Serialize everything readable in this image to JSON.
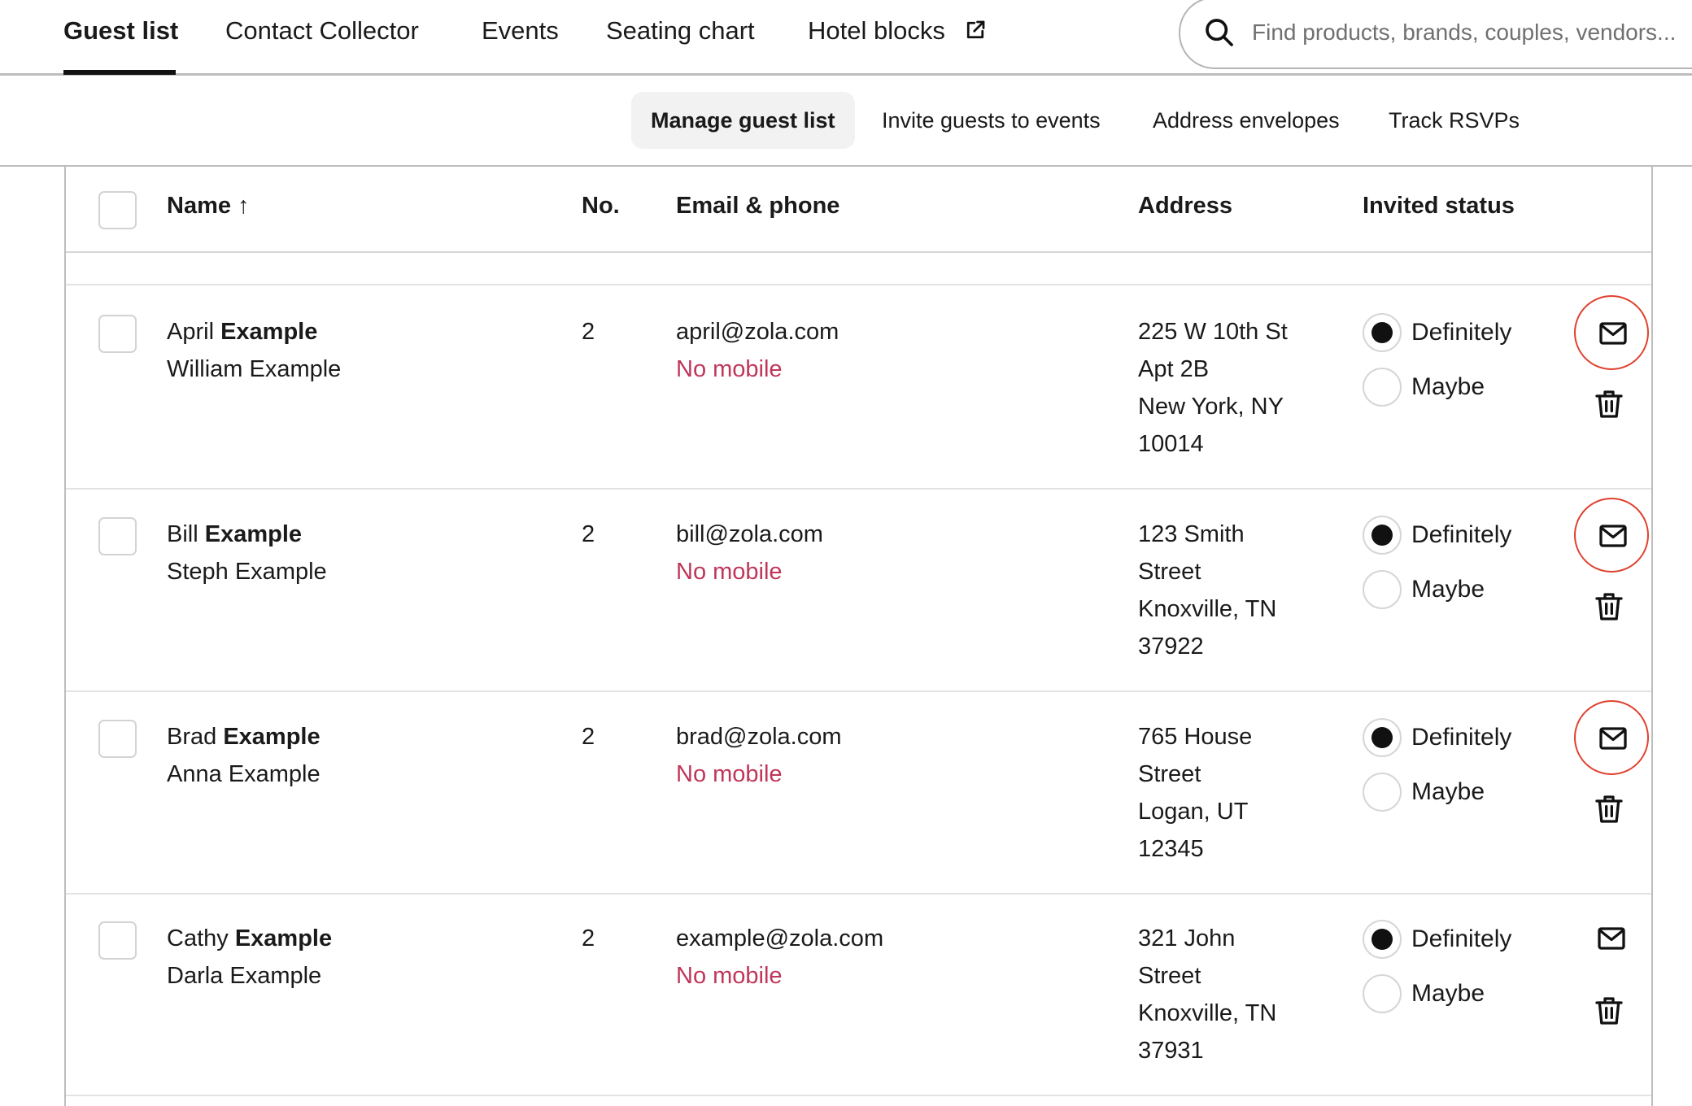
{
  "top_nav": {
    "tabs": [
      {
        "label": "Guest list",
        "active": true
      },
      {
        "label": "Contact Collector",
        "active": false
      },
      {
        "label": "Events",
        "active": false
      },
      {
        "label": "Seating chart",
        "active": false
      },
      {
        "label": "Hotel blocks",
        "active": false,
        "icon": "external-link-icon"
      }
    ],
    "search": {
      "placeholder": "Find products, brands, couples, vendors...",
      "value": "",
      "icon": "search-icon"
    }
  },
  "sub_nav": {
    "items": [
      {
        "label": "Manage guest list",
        "active": true
      },
      {
        "label": "Invite guests to events",
        "active": false
      },
      {
        "label": "Address envelopes",
        "active": false
      },
      {
        "label": "Track RSVPs",
        "active": false
      }
    ]
  },
  "table": {
    "columns": {
      "name": "Name",
      "name_sort_icon": "↑",
      "no": "No.",
      "email_phone": "Email & phone",
      "address": "Address",
      "invited_status": "Invited status"
    },
    "status_options": [
      "Definitely",
      "Maybe"
    ],
    "colors": {
      "no_mobile": "#c0365a",
      "highlight_ring": "#e0402e"
    },
    "rows": [
      {
        "primary_first": "April",
        "primary_last": "Example",
        "secondary": "William Example",
        "count": "2",
        "email": "april@zola.com",
        "phone": "No mobile",
        "address": [
          "225 W 10th St",
          "Apt 2B",
          "New York, NY",
          "10014"
        ],
        "status": "Definitely",
        "email_highlighted": true
      },
      {
        "primary_first": "Bill",
        "primary_last": "Example",
        "secondary": "Steph Example",
        "count": "2",
        "email": "bill@zola.com",
        "phone": "No mobile",
        "address": [
          "123 Smith",
          "Street",
          "Knoxville, TN",
          "37922"
        ],
        "status": "Definitely",
        "email_highlighted": true
      },
      {
        "primary_first": "Brad",
        "primary_last": "Example",
        "secondary": "Anna Example",
        "count": "2",
        "email": "brad@zola.com",
        "phone": "No mobile",
        "address": [
          "765 House",
          "Street",
          "Logan, UT",
          "12345"
        ],
        "status": "Definitely",
        "email_highlighted": true
      },
      {
        "primary_first": "Cathy",
        "primary_last": "Example",
        "secondary": "Darla Example",
        "count": "2",
        "email": "example@zola.com",
        "phone": "No mobile",
        "address": [
          "321 John",
          "Street",
          "Knoxville, TN",
          "37931"
        ],
        "status": "Definitely",
        "email_highlighted": false
      }
    ]
  }
}
